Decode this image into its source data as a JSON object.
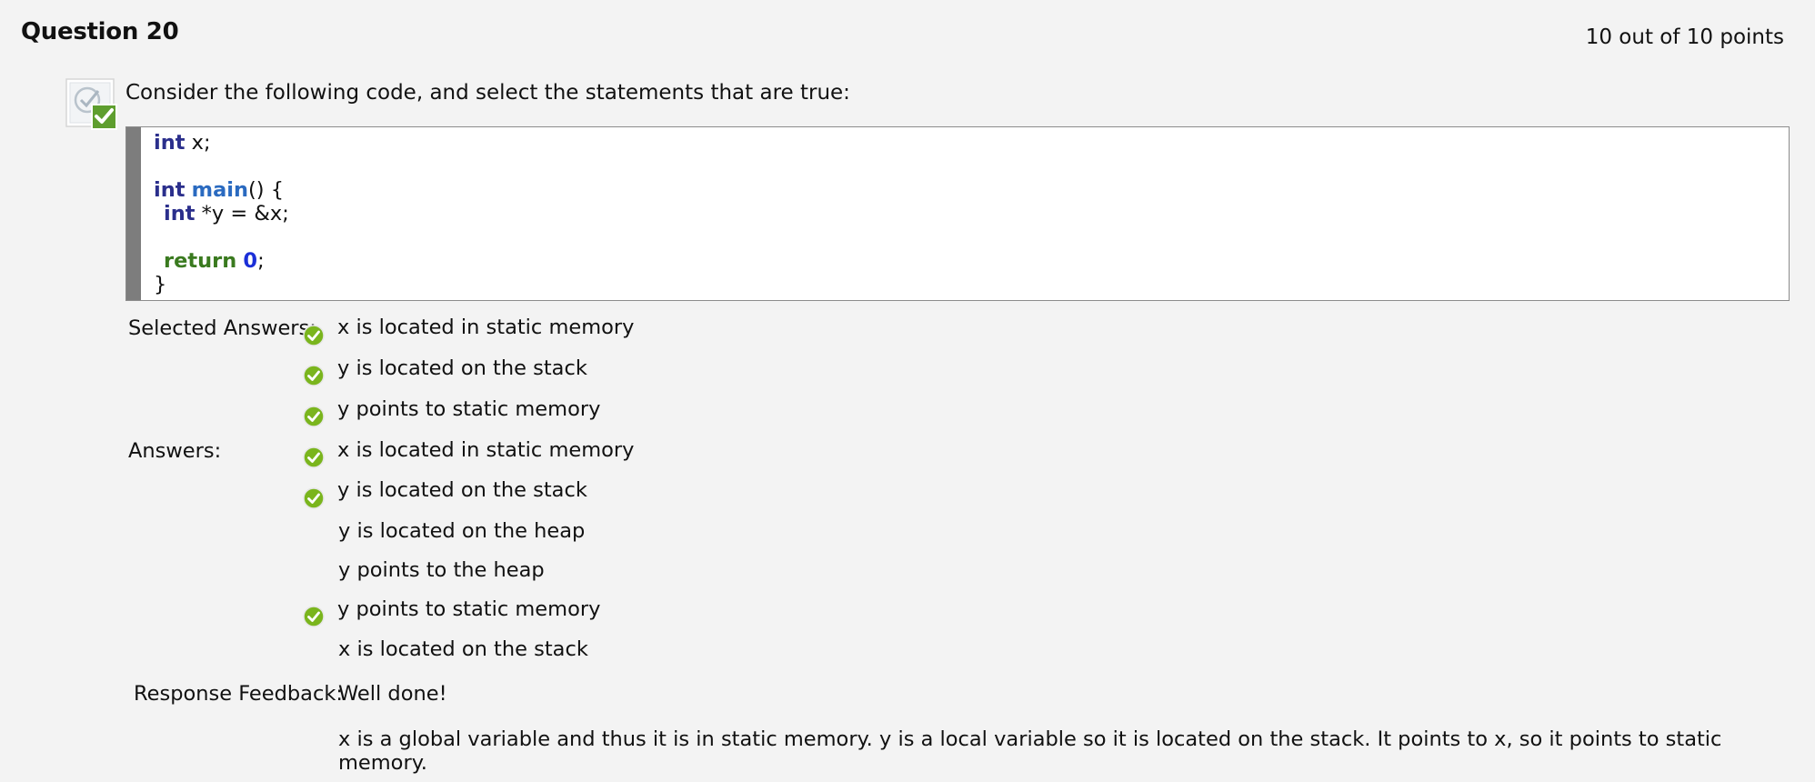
{
  "question": {
    "title": "Question 20",
    "points": "10 out of 10 points",
    "prompt": "Consider the following code, and select the statements that are true:"
  },
  "code": {
    "line1_kw": "int",
    "line1_rest": " x;",
    "line2_kw": "int",
    "line2_fn": "main",
    "line2_rest": "() {",
    "line3_kw": "int",
    "line3_rest": " *y = &x;",
    "line4_kw": "return",
    "line4_num": "0",
    "line4_rest": ";",
    "line5": "}"
  },
  "labels": {
    "selected_answers": "Selected Answers:",
    "answers": "Answers:",
    "response_feedback": "Response Feedback:"
  },
  "selected_answers": [
    "x is located in static memory",
    "y is located on the stack",
    "y points to static memory"
  ],
  "answers": [
    "x is located in static memory",
    "y is located on the stack",
    "y is located on the heap",
    "y points to the heap",
    "y points to static memory",
    "x is located on the stack"
  ],
  "feedback": {
    "short": "Well done!",
    "explanation": "x is a global variable and thus it is in static memory. y is a local variable so it is located on the stack. It points to x, so it points to static memory."
  },
  "colors": {
    "background": "#f3f3f3",
    "check_green": "#7ab51d",
    "code_keyword": "#2b2f8c",
    "code_function": "#2a6ac0",
    "code_return": "#3a7a1f",
    "code_number": "#1b2fd8"
  }
}
